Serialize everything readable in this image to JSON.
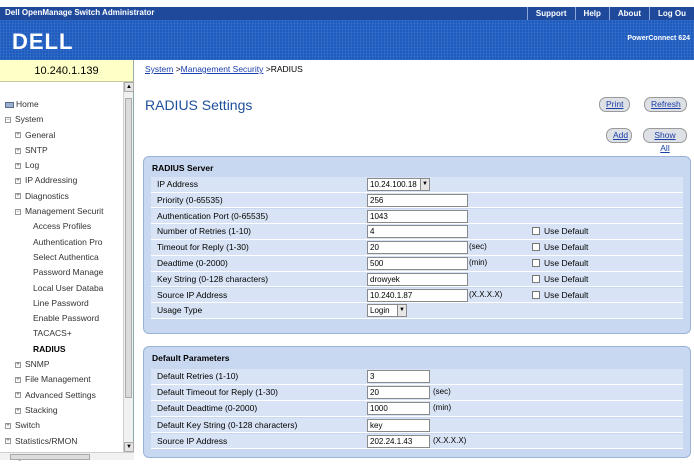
{
  "app": {
    "title": "Dell OpenManage Switch Administrator",
    "links": [
      "Support",
      "Help",
      "About",
      "Log Ou"
    ],
    "logo": "DELL",
    "model": "PowerConnect 624"
  },
  "ip": "10.240.1.139",
  "breadcrumb": {
    "items": [
      "System",
      "Management Security"
    ],
    "current": "RADIUS",
    "sep": " >"
  },
  "page_title": "RADIUS Settings",
  "buttons": {
    "print": "Print",
    "refresh": "Refresh",
    "add": "Add",
    "show_all": "Show All"
  },
  "tree": [
    {
      "label": "Home",
      "kind": "home"
    },
    {
      "label": "System",
      "kind": "minus"
    },
    {
      "label": "General",
      "kind": "plus"
    },
    {
      "label": "SNTP",
      "kind": "plus"
    },
    {
      "label": "Log",
      "kind": "plus"
    },
    {
      "label": "IP Addressing",
      "kind": "plus"
    },
    {
      "label": "Diagnostics",
      "kind": "plus"
    },
    {
      "label": "Management Securit",
      "kind": "minus"
    },
    {
      "label": "Access Profiles",
      "kind": "leaf"
    },
    {
      "label": "Authentication Pro",
      "kind": "leaf"
    },
    {
      "label": "Select Authentica",
      "kind": "leaf"
    },
    {
      "label": "Password Manage",
      "kind": "leaf"
    },
    {
      "label": "Local User Databa",
      "kind": "leaf"
    },
    {
      "label": "Line Password",
      "kind": "leaf"
    },
    {
      "label": "Enable Password",
      "kind": "leaf"
    },
    {
      "label": "TACACS+",
      "kind": "leaf"
    },
    {
      "label": "RADIUS",
      "kind": "active"
    },
    {
      "label": "SNMP",
      "kind": "plus"
    },
    {
      "label": "File Management",
      "kind": "plus"
    },
    {
      "label": "Advanced Settings",
      "kind": "plus"
    },
    {
      "label": "Stacking",
      "kind": "plus"
    },
    {
      "label": "Switch",
      "kind": "plus-top"
    },
    {
      "label": "Statistics/RMON",
      "kind": "plus-top"
    },
    {
      "label": "QOS",
      "kind": "plus-top"
    }
  ],
  "radius_server": {
    "heading": "RADIUS Server",
    "rows": [
      {
        "label": "IP Address",
        "value": "10.24.100.18"
      },
      {
        "label": "Priority (0-65535)",
        "value": "256"
      },
      {
        "label": "Authentication Port (0-65535)",
        "value": "1043"
      },
      {
        "label": "Number of Retries (1-10)",
        "value": "4",
        "check": "Use Default"
      },
      {
        "label": "Timeout for Reply (1-30)",
        "value": "20",
        "unit": "(sec)",
        "check": "Use Default"
      },
      {
        "label": "Deadtime (0-2000)",
        "value": "500",
        "unit": "(min)",
        "check": "Use Default"
      },
      {
        "label": "Key String (0-128 characters)",
        "value": "drowyek",
        "check": "Use Default"
      },
      {
        "label": "Source IP Address",
        "value": "10.240.1.87",
        "unit": "(X.X.X.X)",
        "check": "Use Default"
      },
      {
        "label": "Usage Type",
        "value": "Login"
      }
    ]
  },
  "default_params": {
    "heading": "Default Parameters",
    "rows": [
      {
        "label": "Default Retries (1-10)",
        "value": "3"
      },
      {
        "label": "Default Timeout for Reply (1-30)",
        "value": "20",
        "unit": "(sec)"
      },
      {
        "label": "Default Deadtime (0-2000)",
        "value": "1000",
        "unit": "(min)"
      },
      {
        "label": "Default Key String (0-128 characters)",
        "value": "key"
      },
      {
        "label": "Source IP Address",
        "value": "202.24.1.43",
        "unit": "(X.X.X.X)"
      }
    ]
  }
}
